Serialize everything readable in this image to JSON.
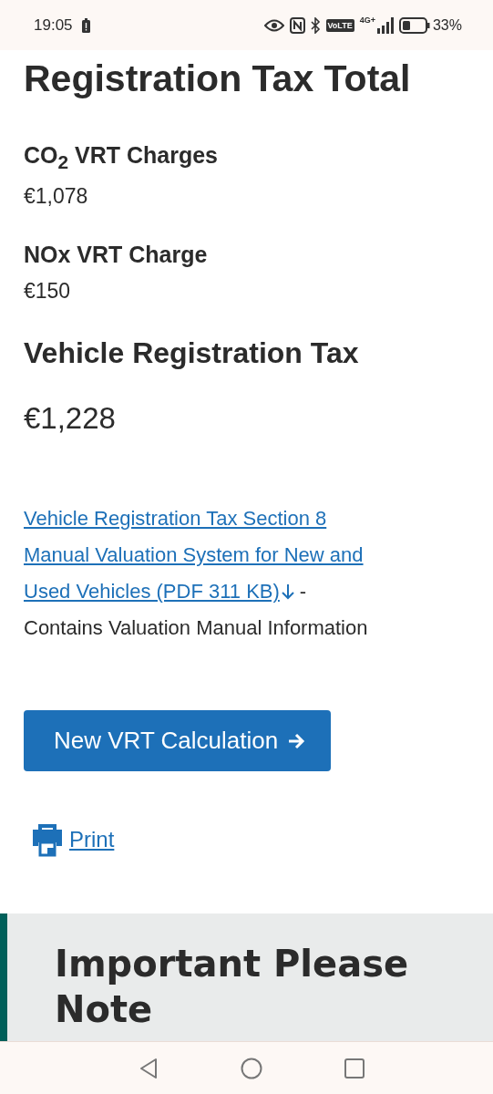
{
  "status_bar": {
    "time": "19:05",
    "network": "4G+",
    "volte": "VoLTE",
    "battery_percent": "33%"
  },
  "summary": {
    "title": "Registration Tax Total",
    "charges": [
      {
        "label": "CO$_{2}$ VRT Charges",
        "amount": "€1,078"
      },
      {
        "label": "NOx VRT Charge",
        "amount": "€150"
      }
    ],
    "total_label": "Vehicle Registration Tax",
    "total_amount": "€1,228"
  },
  "download": {
    "link_lines": [
      "Vehicle Registration Tax Section 8",
      "Manual Valuation System for New and",
      "Used Vehicles (PDF 311 KB)"
    ],
    "separator": "-",
    "description": "Contains Valuation Manual Information"
  },
  "new_calculation_button": "New VRT Calculation",
  "print_link": "Print",
  "notice": {
    "title": "Important Please Note"
  }
}
